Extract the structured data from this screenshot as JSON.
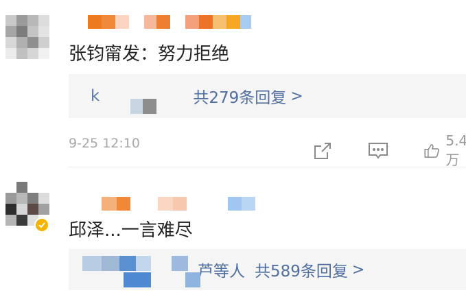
{
  "comments": [
    {
      "content": "张钧甯发：努力拒绝",
      "reply_prefix": "k",
      "reply_count_label": "共279条回复",
      "reply_chevron": ">",
      "time": "9-25 12:10",
      "like_count": "5.4万",
      "icons": [
        "share-icon",
        "comment-icon",
        "like-icon"
      ]
    },
    {
      "content": "邱泽...一言难尽",
      "reply_names": "芦等人",
      "reply_count_label": "共589条回复",
      "reply_chevron": ">",
      "verified": true,
      "icons": [
        "verified-badge-icon"
      ]
    }
  ],
  "colors": {
    "reply_link": "#4f6fa0",
    "reply_bg": "#f5f5f5",
    "meta_text": "#a8a8a8",
    "verified_badge": "#f4b400"
  }
}
